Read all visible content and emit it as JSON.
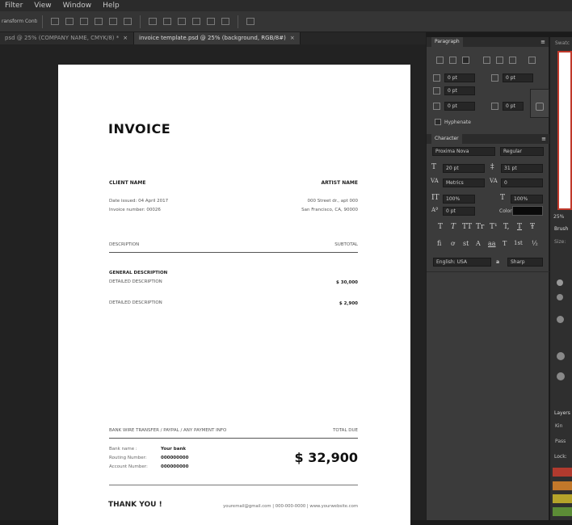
{
  "menu": [
    "Filter",
    "View",
    "Window",
    "Help"
  ],
  "options": {
    "label": "ransform Controls"
  },
  "tabs": [
    {
      "label": "psd @ 25% (COMPANY NAME, CMYK/8) *",
      "close": "×"
    },
    {
      "label": "invoice template.psd @ 25% (background, RGB/8#)",
      "close": "×"
    }
  ],
  "invoice": {
    "title": "INVOICE",
    "client_label": "CLIENT NAME",
    "artist_label": "ARTIST NAME",
    "date": "Date issued: 04 April 2017",
    "number": "Invoice number: 00026",
    "address1": "000 Street dr., apt 000",
    "address2": "San Francisco, CA, 90000",
    "col_desc": "DESCRIPTION",
    "col_sub": "SUBTOTAL",
    "general": "GENERAL DESCRIPTION",
    "items": [
      {
        "desc": "DETAILED DESCRIPTION",
        "amount": "$ 30,000"
      },
      {
        "desc": "DETAILED DESCRIPTION",
        "amount": "$ 2,900"
      }
    ],
    "pay_info": "BANK WIRE TRANSFER / PAYPAL / ANY PAYMENT INFO",
    "total_label": "TOTAL DUE",
    "bank_label": "Bank name :",
    "bank_value": "Your bank",
    "routing_label": "Routing Number:",
    "routing_value": "000000000",
    "account_label": "Account Number:",
    "account_value": "000000000",
    "total": "$ 32,900",
    "thanks": "THANK YOU !",
    "contact": "youremail@gmail.com | 000-000-0000 | www.yourwebsite.com"
  },
  "paragraph": {
    "title": "Paragraph",
    "indent_left": "0 pt",
    "indent_right": "0 pt",
    "first_line": "0 pt",
    "space_before": "0 pt",
    "space_after": "0 pt",
    "hyphenate": "Hyphenate"
  },
  "character": {
    "title": "Character",
    "font": "Proxima Nova",
    "style": "Regular",
    "size": "20 pt",
    "leading": "31 pt",
    "kerning": "Metrics",
    "tracking": "0",
    "vscale": "100%",
    "hscale": "100%",
    "baseline": "0 pt",
    "color_label": "Color:",
    "glyphs": [
      "T",
      "T",
      "TT",
      "Tr",
      "T¹",
      "T,",
      "T",
      "Ŧ"
    ],
    "opentype": [
      "fi",
      "ơ",
      "st",
      "A",
      "aa",
      "T",
      "1st",
      "½"
    ],
    "language": "English: USA",
    "aa_label": "a",
    "aa": "Sharp"
  },
  "right": {
    "swatches_label": "Swatc",
    "zoom": "25%",
    "brush_label": "Brush",
    "size_label": "Size:",
    "layers_label": "Layers",
    "kind_label": "Kin",
    "pass_label": "Pass",
    "lock_label": "Lock:"
  },
  "colors": {
    "bg": "#1b1b1b",
    "panel": "#3b3b3b",
    "eye_red": "#b13a2e",
    "eye_orange": "#c2782a",
    "eye_yellow": "#b5a32a",
    "eye_green": "#5c8c36"
  }
}
